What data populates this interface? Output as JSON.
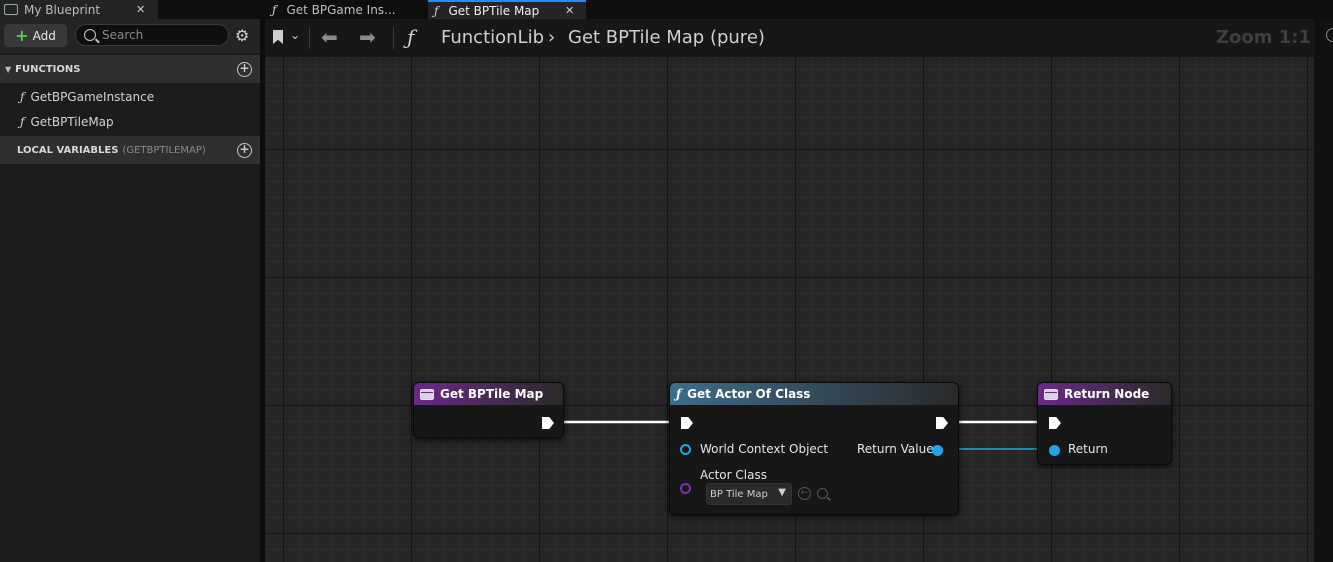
{
  "tabs": [
    {
      "label": "My Blueprint",
      "closable": true
    },
    {
      "label": "Get BPGame Ins...",
      "icon": "function-icon"
    },
    {
      "label": "Get BPTile Map",
      "icon": "function-icon",
      "closable": true,
      "active": true
    }
  ],
  "left_panel": {
    "add_label": "Add",
    "search_placeholder": "Search",
    "functions_header": "FUNCTIONS",
    "functions": [
      "GetBPGameInstance",
      "GetBPTileMap"
    ],
    "local_vars_header": "LOCAL VARIABLES",
    "local_vars_scope": "(GETBPTILEMAP)"
  },
  "graph": {
    "breadcrumb": [
      "FunctionLib",
      "Get BPTile Map (pure)"
    ],
    "zoom": "Zoom 1:1"
  },
  "nodes": {
    "entry": {
      "title": "Get BPTile Map"
    },
    "get_actor": {
      "title": "Get Actor Of Class",
      "world_context": "World Context Object",
      "actor_class": "Actor Class",
      "class_value": "BP Tile Map",
      "return_value": "Return Value"
    },
    "return": {
      "title": "Return Node",
      "return_pin": "Return"
    }
  },
  "colors": {
    "exec_wire": "#ffffff",
    "data_wire": "#1aa7ec",
    "function_header": "#3d6c8c",
    "entry_header": "#6a2a86",
    "class_pin": "#7e2db5"
  }
}
